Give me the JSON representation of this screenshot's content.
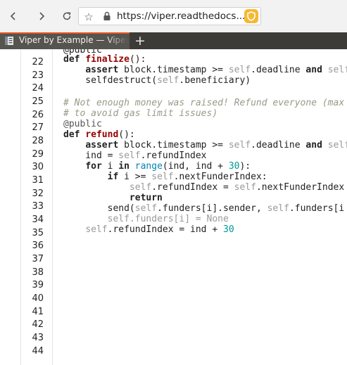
{
  "browser": {
    "url": "https://viper.readthedocs...",
    "tab_title": "Viper by Example — Viper documentation",
    "new_tab_symbol": "+",
    "extension_color": "#f6b833"
  },
  "icons": [
    "back-arrow-icon",
    "forward-arrow-icon",
    "reload-icon",
    "bookmark-star-icon",
    "padlock-icon",
    "shield-icon",
    "document-icon",
    "plus-icon"
  ],
  "colors": {
    "tab_accent": "#e95420",
    "keyword": "#222222",
    "function_name": "#990000",
    "self": "#999999",
    "number": "#009999",
    "builtin": "#0086b3",
    "comment": "#999988"
  },
  "code": {
    "lines": [
      {
        "n": "22",
        "tokens": [
          {
            "t": "def",
            "c": "kw"
          },
          {
            "t": " ",
            "c": ""
          },
          {
            "t": "finalize",
            "c": "fn"
          },
          {
            "t": "():",
            "c": ""
          }
        ]
      },
      {
        "n": "23",
        "tokens": [
          {
            "t": "    ",
            "c": ""
          },
          {
            "t": "assert",
            "c": "kw"
          },
          {
            "t": " block.timestamp >= ",
            "c": ""
          },
          {
            "t": "self",
            "c": "slf"
          },
          {
            "t": ".deadline ",
            "c": ""
          },
          {
            "t": "and",
            "c": "kw"
          },
          {
            "t": " ",
            "c": ""
          },
          {
            "t": "self",
            "c": "slf"
          }
        ]
      },
      {
        "n": "24",
        "tokens": [
          {
            "t": "    selfdestruct(",
            "c": ""
          },
          {
            "t": "self",
            "c": "slf"
          },
          {
            "t": ".beneficiary)",
            "c": ""
          }
        ]
      },
      {
        "n": "25",
        "tokens": []
      },
      {
        "n": "26",
        "tokens": [
          {
            "t": "# Not enough money was raised! Refund everyone (max",
            "c": "cm"
          }
        ]
      },
      {
        "n": "",
        "tokens": [
          {
            "t": "# to avoid gas limit issues)",
            "c": "cm"
          }
        ]
      },
      {
        "n": "27",
        "tokens": [
          {
            "t": "@public",
            "c": "dec"
          }
        ]
      },
      {
        "n": "28",
        "tokens": [
          {
            "t": "def",
            "c": "kw"
          },
          {
            "t": " ",
            "c": ""
          },
          {
            "t": "refund",
            "c": "fn"
          },
          {
            "t": "():",
            "c": ""
          }
        ]
      },
      {
        "n": "29",
        "tokens": [
          {
            "t": "    ",
            "c": ""
          },
          {
            "t": "assert",
            "c": "kw"
          },
          {
            "t": " block.timestamp >= ",
            "c": ""
          },
          {
            "t": "self",
            "c": "slf"
          },
          {
            "t": ".deadline ",
            "c": ""
          },
          {
            "t": "and",
            "c": "kw"
          },
          {
            "t": " ",
            "c": ""
          },
          {
            "t": "self",
            "c": "slf"
          }
        ]
      },
      {
        "n": "",
        "tokens": [
          {
            "t": "    ind = ",
            "c": ""
          },
          {
            "t": "self",
            "c": "slf"
          },
          {
            "t": ".refundIndex",
            "c": ""
          }
        ]
      },
      {
        "n": "30",
        "tokens": [
          {
            "t": "    ",
            "c": ""
          },
          {
            "t": "for",
            "c": "kw"
          },
          {
            "t": " i ",
            "c": ""
          },
          {
            "t": "in",
            "c": "kw"
          },
          {
            "t": " ",
            "c": ""
          },
          {
            "t": "range",
            "c": "bi"
          },
          {
            "t": "(ind, ind + ",
            "c": ""
          },
          {
            "t": "30",
            "c": "num"
          },
          {
            "t": "):",
            "c": ""
          }
        ]
      },
      {
        "n": "31",
        "tokens": [
          {
            "t": "        ",
            "c": ""
          },
          {
            "t": "if",
            "c": "kw"
          },
          {
            "t": " i >= ",
            "c": ""
          },
          {
            "t": "self",
            "c": "slf"
          },
          {
            "t": ".nextFunderIndex:",
            "c": ""
          }
        ]
      },
      {
        "n": "32",
        "tokens": [
          {
            "t": "            ",
            "c": ""
          },
          {
            "t": "self",
            "c": "slf"
          },
          {
            "t": ".refundIndex = ",
            "c": ""
          },
          {
            "t": "self",
            "c": "slf"
          },
          {
            "t": ".nextFunderIndex",
            "c": ""
          }
        ]
      },
      {
        "n": "",
        "tokens": [
          {
            "t": "            ",
            "c": ""
          },
          {
            "t": "return",
            "c": "kw"
          }
        ]
      },
      {
        "n": "33",
        "tokens": [
          {
            "t": "        send(",
            "c": ""
          },
          {
            "t": "self",
            "c": "slf"
          },
          {
            "t": ".funders[i].sender, ",
            "c": ""
          },
          {
            "t": "self",
            "c": "slf"
          },
          {
            "t": ".funders[i",
            "c": ""
          }
        ]
      },
      {
        "n": "34",
        "tokens": [
          {
            "t": "        ",
            "c": ""
          },
          {
            "t": "self",
            "c": "slf"
          },
          {
            "t": ".funders[i] = None",
            "c": "slf"
          }
        ]
      },
      {
        "n": "35",
        "tokens": [
          {
            "t": "    ",
            "c": ""
          },
          {
            "t": "self",
            "c": "slf"
          },
          {
            "t": ".refundIndex = ind + ",
            "c": ""
          },
          {
            "t": "30",
            "c": "num"
          }
        ]
      },
      {
        "n": "36",
        "tokens": []
      },
      {
        "n": "37",
        "tokens": []
      },
      {
        "n": "38",
        "tokens": []
      },
      {
        "n": "39",
        "tokens": []
      },
      {
        "n": "40",
        "tokens": []
      },
      {
        "n": "41",
        "tokens": []
      },
      {
        "n": "42",
        "tokens": []
      },
      {
        "n": "43",
        "tokens": []
      },
      {
        "n": "44",
        "tokens": []
      }
    ],
    "partial_top_text": "@public"
  }
}
